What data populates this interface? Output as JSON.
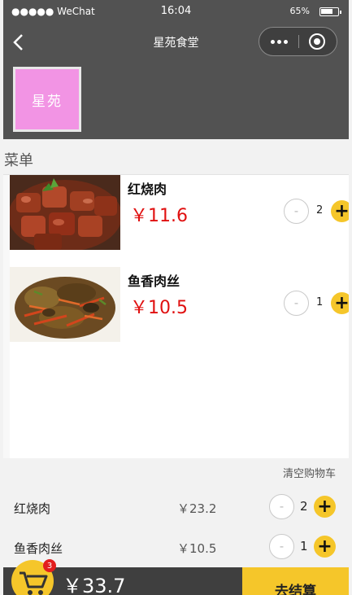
{
  "status_bar": {
    "carrier": "●●●●● WeChat",
    "time": "16:04",
    "battery": "65%"
  },
  "nav": {
    "title": "星苑食堂"
  },
  "logo": {
    "text": "星苑",
    "color": "#f294e4"
  },
  "section": {
    "title": "菜单"
  },
  "menu": [
    {
      "name": "红烧肉",
      "price": "￥11.6",
      "qty": "2",
      "minus": "-",
      "plus": "+"
    },
    {
      "name": "鱼香肉丝",
      "price": "￥10.5",
      "qty": "1",
      "minus": "-",
      "plus": "+"
    }
  ],
  "cart": {
    "clear_label": "清空购物车",
    "items": [
      {
        "name": "红烧肉",
        "price": "￥23.2",
        "qty": "2",
        "minus": "-",
        "plus": "+"
      },
      {
        "name": "鱼香肉丝",
        "price": "￥10.5",
        "qty": "1",
        "minus": "-",
        "plus": "+"
      }
    ]
  },
  "bottom": {
    "badge": "3",
    "total": "￥33.7",
    "checkout_label": "去结算"
  },
  "colors": {
    "accent": "#f5c62a",
    "price": "#e01010",
    "bar": "#525252"
  }
}
